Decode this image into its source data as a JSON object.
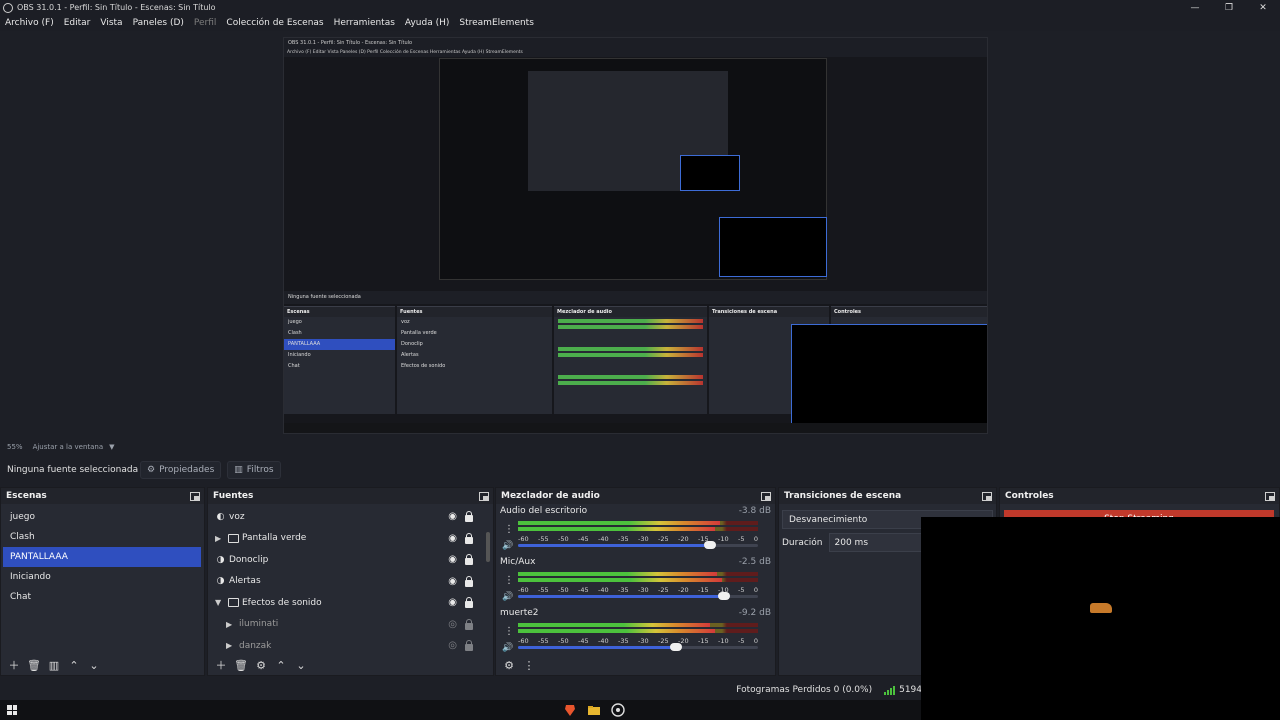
{
  "window": {
    "title": "OBS 31.0.1 - Perfil: Sin Título - Escenas: Sin Título",
    "controls": [
      "—",
      "❐",
      "✕"
    ]
  },
  "menu": {
    "items": [
      {
        "label": "Archivo (F)",
        "enabled": true
      },
      {
        "label": "Editar",
        "enabled": true
      },
      {
        "label": "Vista",
        "enabled": true
      },
      {
        "label": "Paneles (D)",
        "enabled": true
      },
      {
        "label": "Perfil",
        "enabled": false
      },
      {
        "label": "Colección de Escenas",
        "enabled": true
      },
      {
        "label": "Herramientas",
        "enabled": true
      },
      {
        "label": "Ayuda (H)",
        "enabled": true
      },
      {
        "label": "StreamElements",
        "enabled": true
      }
    ]
  },
  "preview": {
    "nested_title": "OBS 31.0.1 - Perfil: Sin Título - Escenas: Sin Título",
    "nested_menu": "Archivo (F)  Editar  Vista  Paneles (D)  Perfil  Colección de Escenas  Herramientas  Ayuda (H)  StreamElements",
    "nested_status": "55%  Ajustar a la ventana",
    "nested_no_source": "Ninguna fuente seleccionada"
  },
  "zoom": {
    "level": "55%",
    "mode": "Ajustar a la ventana"
  },
  "source_toolbar": {
    "no_source": "Ninguna fuente seleccionada",
    "properties": "Propiedades",
    "filters": "Filtros"
  },
  "scenes": {
    "title": "Escenas",
    "items": [
      "juego",
      "Clash",
      "PANTALLAAA",
      "Iniciando",
      "Chat"
    ],
    "selected_index": 2
  },
  "sources": {
    "title": "Fuentes",
    "items": [
      {
        "label": "voz",
        "type": "audio",
        "visible": true,
        "locked": true,
        "indent": 0
      },
      {
        "label": "Pantalla verde",
        "type": "group",
        "expanded": false,
        "visible": true,
        "locked": true,
        "indent": 0
      },
      {
        "label": "Donoclip",
        "type": "browser",
        "visible": true,
        "locked": true,
        "indent": 0
      },
      {
        "label": "Alertas",
        "type": "browser",
        "visible": true,
        "locked": true,
        "indent": 0
      },
      {
        "label": "Efectos de sonido",
        "type": "group",
        "expanded": true,
        "visible": true,
        "locked": true,
        "indent": 0
      },
      {
        "label": "iluminati",
        "type": "media",
        "visible": false,
        "locked": true,
        "indent": 1
      },
      {
        "label": "danzak",
        "type": "media",
        "visible": false,
        "locked": true,
        "indent": 1
      }
    ]
  },
  "mixer": {
    "title": "Mezclador de audio",
    "ticks": [
      "-60",
      "-55",
      "-50",
      "-45",
      "-40",
      "-35",
      "-30",
      "-25",
      "-20",
      "-15",
      "-10",
      "-5",
      "0"
    ],
    "channels": [
      {
        "name": "Audio del escritorio",
        "db": "-3.8 dB",
        "level1": 0.84,
        "level2": 0.82,
        "volume": 0.8
      },
      {
        "name": "Mic/Aux",
        "db": "-2.5 dB",
        "level1": 0.83,
        "level2": 0.85,
        "volume": 0.86
      },
      {
        "name": "muerte2",
        "db": "-9.2 dB",
        "level1": 0.8,
        "level2": 0.82,
        "volume": 0.66
      }
    ]
  },
  "transitions": {
    "title": "Transiciones de escena",
    "selected": "Desvanecimiento",
    "duration_label": "Duración",
    "duration_value": "200 ms"
  },
  "controls": {
    "title": "Controles",
    "stop_streaming": "Stop Streaming"
  },
  "status": {
    "dropped_frames": "Fotogramas Perdidos 0 (0.0%)",
    "kbps": "5194"
  }
}
